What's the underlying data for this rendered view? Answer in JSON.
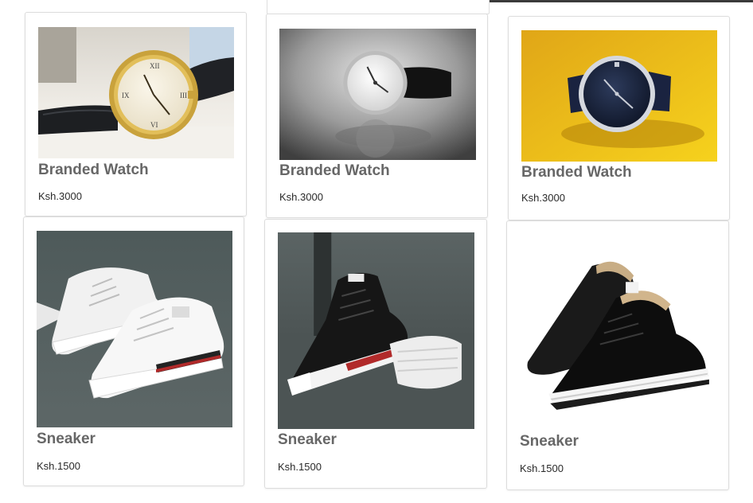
{
  "products": [
    {
      "name": "Branded Watch",
      "price": "Ksh.3000",
      "image": "gold-watch-photo"
    },
    {
      "name": "Branded Watch",
      "price": "Ksh.3000",
      "image": "silver-watch-photo"
    },
    {
      "name": "Branded Watch",
      "price": "Ksh.3000",
      "image": "blue-watch-photo"
    },
    {
      "name": "Sneaker",
      "price": "Ksh.1500",
      "image": "white-sneaker-photo"
    },
    {
      "name": "Sneaker",
      "price": "Ksh.1500",
      "image": "black-white-sneaker-photo"
    },
    {
      "name": "Sneaker",
      "price": "Ksh.1500",
      "image": "black-suede-sneaker-photo"
    }
  ],
  "colors": {
    "card_border": "#dcdcdc",
    "title_text": "#676767",
    "price_text": "#2a2a2a",
    "watch_bg_yellow": "#f2c40f"
  }
}
